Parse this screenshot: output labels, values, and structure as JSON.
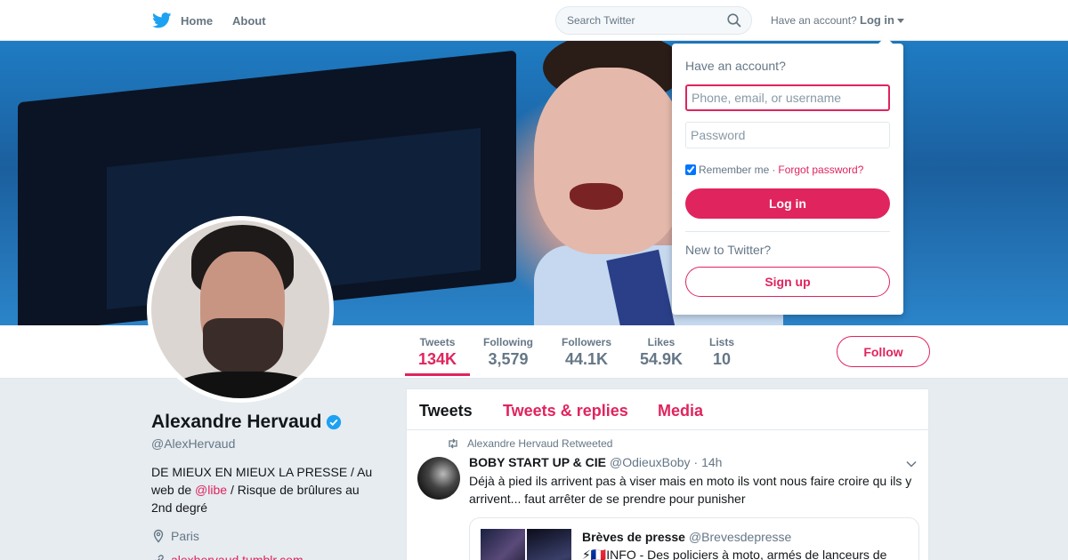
{
  "nav": {
    "home": "Home",
    "about": "About",
    "search_placeholder": "Search Twitter",
    "have_account": "Have an account?",
    "login": "Log in"
  },
  "login_dropdown": {
    "title": "Have an account?",
    "username_placeholder": "Phone, email, or username",
    "password_placeholder": "Password",
    "remember": "Remember me",
    "separator": "·",
    "forgot": "Forgot password?",
    "login_button": "Log in",
    "new_to": "New to Twitter?",
    "signup_button": "Sign up"
  },
  "stats": [
    {
      "label": "Tweets",
      "value": "134K"
    },
    {
      "label": "Following",
      "value": "3,579"
    },
    {
      "label": "Followers",
      "value": "44.1K"
    },
    {
      "label": "Likes",
      "value": "54.9K"
    },
    {
      "label": "Lists",
      "value": "10"
    }
  ],
  "follow_button": "Follow",
  "profile": {
    "name": "Alexandre Hervaud",
    "handle": "@AlexHervaud",
    "bio_before": "DE MIEUX EN MIEUX LA PRESSE / Au web de ",
    "bio_mention": "@libe",
    "bio_after": " / Risque de brûlures au 2nd degré",
    "location": "Paris",
    "website": "alexhervaud.tumblr.com"
  },
  "timeline": {
    "tabs": [
      "Tweets",
      "Tweets & replies",
      "Media"
    ],
    "retweeted_by": "Alexandre Hervaud Retweeted",
    "tweet": {
      "name": "BOBY START UP & CIE",
      "handle": "@OdieuxBoby",
      "time": "· 14h",
      "text": "Déjà à pied ils arrivent pas à viser mais en moto ils vont nous faire croire qu ils y arrivent... faut arrêter de se prendre pour punisher"
    },
    "quote": {
      "name": "Brèves de presse",
      "handle": "@Brevesdepresse",
      "text": "⚡🇫🇷INFO - Des policiers à moto, armés de lanceurs de"
    }
  },
  "colors": {
    "accent": "#e0245e",
    "twitter_blue": "#1da1f2",
    "background": "#e6ecf0"
  }
}
